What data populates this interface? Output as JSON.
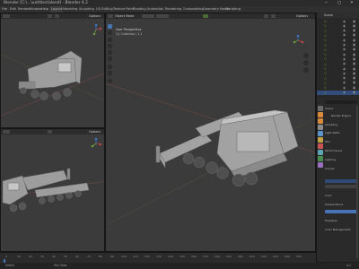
{
  "window": {
    "title": "Blender [C:\\...\\untitled.blend] - Blender 4.2",
    "min": "─",
    "max": "□",
    "close": "✕"
  },
  "menubar": {
    "items": [
      "File",
      "Edit",
      "Render",
      "Window",
      "Help",
      "Layout",
      "Modeling",
      "Sculpting",
      "UV Editing",
      "Texture Paint",
      "Shading",
      "Animation",
      "Rendering",
      "Compositing",
      "Geometry Nodes",
      "Scripting"
    ]
  },
  "viewports": {
    "top_left": {
      "header_right": "Options"
    },
    "bottom_left": {
      "header_right": "Options"
    },
    "main": {
      "mode": "Object Mode",
      "options": "Options",
      "overlay_title": "User Perspective",
      "overlay_subtitle": "(1) Collection | 1.1"
    }
  },
  "outliner": {
    "header": "Scene",
    "rows": [
      "",
      "",
      "",
      "",
      "",
      "",
      "",
      "",
      "",
      "",
      "",
      "",
      "",
      "",
      "",
      ""
    ],
    "highlight_row": 15
  },
  "properties": {
    "search_placeholder": "",
    "panels": [
      "Scene",
      "Render Engine",
      "Sampling",
      "Light Paths",
      "Film",
      "Performance",
      "Lighting",
      "Curves",
      "Color",
      "Grease Pencil",
      "Freestyle",
      "Color Management"
    ],
    "tabs_colors": [
      "#6a6a6a",
      "#d88c3b",
      "#d88c3b",
      "#8a8a8a",
      "#5c93c9",
      "#c2a143",
      "#c95454",
      "#5fa4b2",
      "#4b8c4f",
      "#9a6fbf"
    ]
  },
  "timeline": {
    "frames": [
      "0",
      "10",
      "20",
      "30",
      "40",
      "50",
      "60",
      "70",
      "80",
      "90",
      "100",
      "110",
      "120",
      "130",
      "140",
      "150",
      "160",
      "170",
      "180",
      "190",
      "200",
      "210",
      "220",
      "230",
      "240",
      "250"
    ]
  },
  "status": {
    "left": "Select",
    "mid": "Pan View",
    "right": "4.2"
  },
  "colors": {
    "accent": "#4772b3",
    "background": "#3b3b3b",
    "header": "#2c2c2c",
    "x_axis": "#a0494b",
    "y_axis": "#7a9a4c"
  }
}
